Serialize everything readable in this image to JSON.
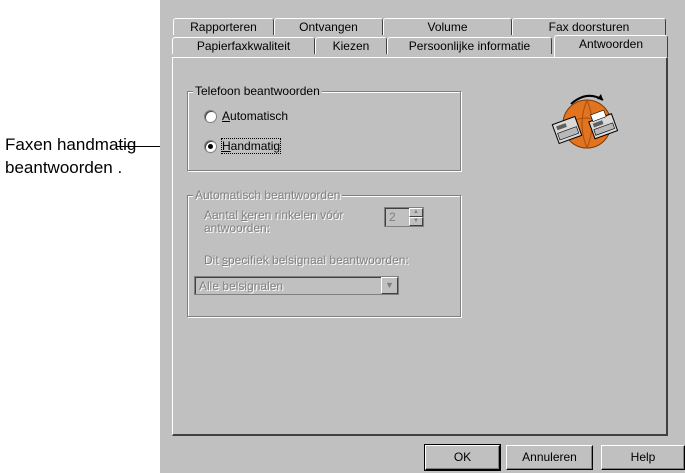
{
  "callout": {
    "text": "Faxen handmatig beantwoorden ."
  },
  "tabs": {
    "row1": [
      "Rapporteren",
      "Ontvangen",
      "Volume",
      "Fax doorsturen"
    ],
    "row2": [
      "Papierfaxkwaliteit",
      "Kiezen",
      "Persoonlijke informatie",
      "Antwoorden"
    ],
    "active": "Antwoorden"
  },
  "answer_phone_group": {
    "title": "Telefoon beantwoorden",
    "options": [
      {
        "label_mnemonic": "A",
        "label_rest": "utomatisch",
        "checked": false
      },
      {
        "label_mnemonic": "H",
        "label_rest": "andmatig",
        "checked": true
      }
    ]
  },
  "auto_answer_group": {
    "title": "Automatisch beantwoorden",
    "rings_label_pre": "Aantal ",
    "rings_label_mnemonic": "k",
    "rings_label_post": "eren rinkelen vóór",
    "rings_label_line2": "antwoorden:",
    "rings_value": "2",
    "ring_signal_label_pre": "Dit ",
    "ring_signal_label_mnemonic": "s",
    "ring_signal_label_post": "pecifiek belsignaal beantwoorden:",
    "ring_signal_value": "Alle belsignalen"
  },
  "buttons": {
    "ok": "OK",
    "cancel": "Annuleren",
    "help": "Help"
  },
  "icons": {
    "fax": "fax-machines-globe-icon",
    "spin_up": "spin-up-icon",
    "spin_down": "spin-down-icon",
    "dropdown": "dropdown-arrow-icon"
  },
  "colors": {
    "dialog_bg": "#c0c0c0",
    "globe": "#e2731f"
  }
}
